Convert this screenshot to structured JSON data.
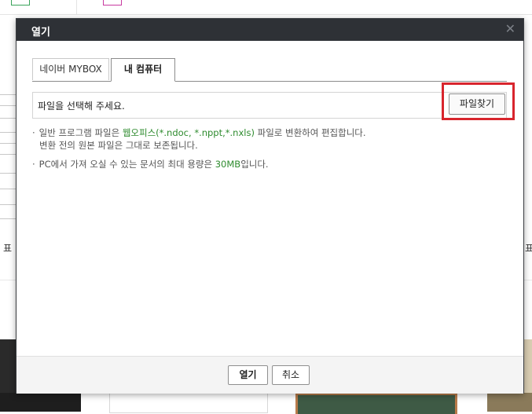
{
  "dialog": {
    "title": "열기",
    "close_icon": "close-icon",
    "tabs": [
      {
        "label": "네이버 MYBOX",
        "selected": false
      },
      {
        "label": "내 컴퓨터",
        "selected": true
      }
    ],
    "file_input_placeholder": "파일을 선택해 주세요.",
    "find_file_button": "파일찾기",
    "notes": {
      "line1_prefix": "일반 프로그램 파일은 ",
      "line1_highlight": "웹오피스(*.ndoc, *.nppt,*.nxls)",
      "line1_suffix": " 파일로 변환하여 편집합니다.",
      "line2": "변환 전의 원본 파일은 그대로 보존됩니다.",
      "line3_prefix": "PC에서 가져 오실 수 있는 문서의 최대 용량은 ",
      "line3_highlight": "30MB",
      "line3_suffix": "입니다."
    },
    "footer": {
      "open_button": "열기",
      "cancel_button": "취소"
    }
  },
  "background": {
    "label_left": "표",
    "label_right": "표"
  },
  "colors": {
    "header_bg": "#2e3136",
    "highlight_border": "#d8252d",
    "note_green": "#2e8b2e"
  }
}
